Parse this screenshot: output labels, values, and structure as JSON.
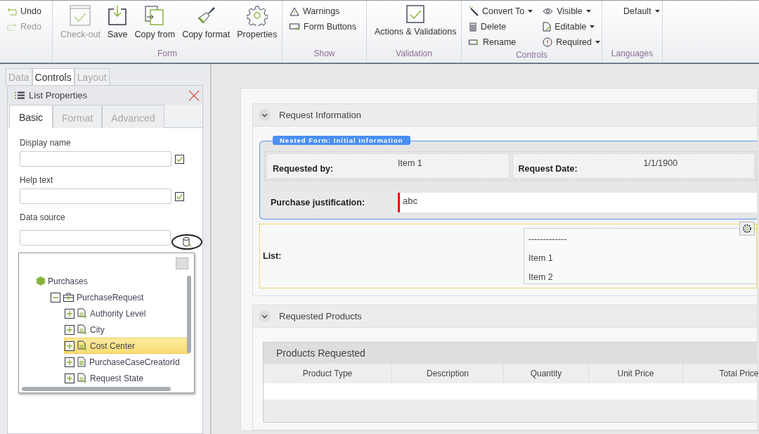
{
  "ribbon": {
    "history": [
      {
        "label": "Undo",
        "disabled": false
      },
      {
        "label": "Redo",
        "disabled": true
      }
    ],
    "groups": [
      {
        "label": "Form",
        "kind": "large",
        "items": [
          {
            "label": "Check-out",
            "disabled": true
          },
          {
            "label": "Save",
            "disabled": false
          },
          {
            "label": "Copy from",
            "disabled": false
          },
          {
            "label": "Copy format",
            "disabled": false
          },
          {
            "label": "Properties",
            "disabled": false
          }
        ]
      },
      {
        "label": "Show",
        "kind": "small",
        "items": [
          {
            "label": "Warnings"
          },
          {
            "label": "Form Buttons"
          }
        ]
      },
      {
        "label": "Validation",
        "kind": "large",
        "items": [
          {
            "label": "Actions & Validations",
            "disabled": false
          }
        ]
      },
      {
        "label": "Controls",
        "kind": "columns",
        "items": [
          {
            "label": "Convert To",
            "dropdown": true
          },
          {
            "label": "Delete",
            "dropdown": false
          },
          {
            "label": "Rename",
            "dropdown": false
          },
          {
            "label": "Visible",
            "dropdown": true
          },
          {
            "label": "Editable",
            "dropdown": true
          },
          {
            "label": "Required",
            "dropdown": true
          }
        ]
      },
      {
        "label": "Languages",
        "kind": "dropdown",
        "items": [
          {
            "label": "Default",
            "dropdown": true
          }
        ]
      }
    ]
  },
  "left_panel": {
    "tabs": [
      {
        "label": "Data",
        "selected": false
      },
      {
        "label": "Controls",
        "selected": true
      },
      {
        "label": "Layout",
        "selected": false
      }
    ],
    "properties": {
      "title": "List Properties",
      "tabs": [
        {
          "label": "Basic",
          "selected": true
        },
        {
          "label": "Format",
          "selected": false
        },
        {
          "label": "Advanced",
          "selected": false
        }
      ],
      "fields": [
        {
          "label": "Display name",
          "kind": "checkbox",
          "checked": true
        },
        {
          "label": "Help text",
          "kind": "checkbox",
          "checked": true
        },
        {
          "label": "Data source",
          "kind": "picker"
        }
      ],
      "tree": [
        {
          "label": "Purchases",
          "kind": "entity",
          "selected": false,
          "children": [
            {
              "label": "PurchaseRequest",
              "kind": "object",
              "expanded": true,
              "selected": false,
              "children": [
                {
                  "label": "Authority Level",
                  "kind": "attribute",
                  "expanded": false,
                  "selected": false
                },
                {
                  "label": "City",
                  "kind": "attribute",
                  "expanded": false,
                  "selected": false
                },
                {
                  "label": "Cost Center",
                  "kind": "attribute",
                  "expanded": false,
                  "selected": true
                },
                {
                  "label": "PurchaseCaseCreatorId",
                  "kind": "number",
                  "expanded": false,
                  "selected": false
                },
                {
                  "label": "Request State",
                  "kind": "attribute",
                  "expanded": false,
                  "selected": false
                }
              ]
            }
          ]
        }
      ]
    }
  },
  "form": {
    "sections": [
      {
        "title": "Request Information",
        "expanded": true,
        "kind": "info",
        "nested_form": {
          "label": "Nested Form: Initial Information",
          "pairs": [
            {
              "label": "Requested by:",
              "value": "Item 1"
            },
            {
              "label": "Request Date:",
              "value": "1/1/1900"
            }
          ],
          "justification": {
            "label": "Purchase justification:",
            "value": "abc",
            "required": true
          }
        },
        "list": {
          "label": "List:",
          "options": [
            "-------------",
            "Item 1",
            "Item 2"
          ]
        }
      },
      {
        "title": "Requested Products",
        "expanded": true,
        "kind": "grid",
        "grid": {
          "title": "Products Requested",
          "columns": [
            "Product Type",
            "Description",
            "Quantity",
            "Unit Price",
            "Total Price"
          ]
        }
      }
    ]
  }
}
